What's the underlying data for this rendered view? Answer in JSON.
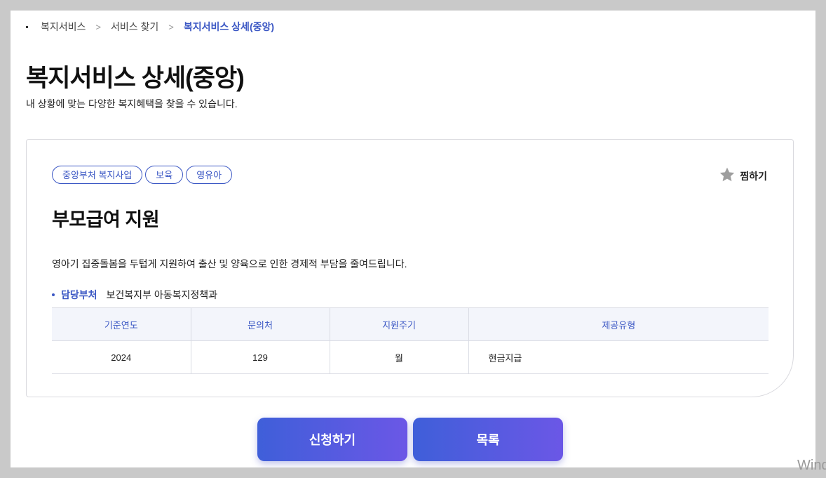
{
  "breadcrumb": [
    "복지서비스",
    "서비스 찾기",
    "복지서비스 상세(중앙)"
  ],
  "page": {
    "title": "복지서비스 상세(중앙)",
    "subtitle": "내 상황에 맞는 다양한 복지혜택을 찾을 수 있습니다."
  },
  "card": {
    "tags": [
      "중앙부처 복지사업",
      "보육",
      "영유아"
    ],
    "favorite_label": "찜하기",
    "title": "부모급여 지원",
    "description": "영아기 집중돌봄을 두텁게 지원하여 출산 및 양육으로 인한 경제적 부담을 줄여드립니다.",
    "dept_label": "담당부처",
    "dept_value": "보건복지부 아동복지정책과",
    "table": {
      "headers": [
        "기준연도",
        "문의처",
        "지원주기",
        "제공유형"
      ],
      "row": [
        "2024",
        "129",
        "월",
        "현금지급"
      ]
    }
  },
  "buttons": {
    "apply": "신청하기",
    "list": "목록"
  },
  "colors": {
    "accent": "#3b57c4",
    "gradient_start": "#3f5fd9",
    "gradient_end": "#6b57e6"
  },
  "icons": {
    "favorite": "star-icon"
  },
  "watermark": "Wind"
}
